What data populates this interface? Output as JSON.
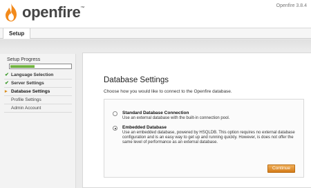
{
  "header": {
    "logo_text": "openfire",
    "trademark": "™",
    "version": "Openfire 3.8.4",
    "brand_color": "#f28a1c"
  },
  "tabs": {
    "setup_label": "Setup"
  },
  "sidebar": {
    "progress_title": "Setup Progress",
    "progress_fraction": 0.4,
    "progress_color": "#5ba82a",
    "steps": [
      {
        "label": "Language Selection",
        "status": "done",
        "icon": "check-icon"
      },
      {
        "label": "Server Settings",
        "status": "done",
        "icon": "check-icon"
      },
      {
        "label": "Database Settings",
        "status": "current",
        "icon": "arrow-icon"
      },
      {
        "label": "Profile Settings",
        "status": "todo",
        "icon": ""
      },
      {
        "label": "Admin Account",
        "status": "todo",
        "icon": ""
      }
    ]
  },
  "main": {
    "title": "Database Settings",
    "intro": "Choose how you would like to connect to the Openfire database.",
    "options": [
      {
        "title": "Standard Database Connection",
        "description": "Use an external database with the built-in connection pool.",
        "selected": false
      },
      {
        "title": "Embedded Database",
        "description": "Use an embedded database, powered by HSQLDB. This option requires no external database configuration and is an easy way to get up and running quickly. However, is does not offer the same level of performance as an external database.",
        "selected": true
      }
    ],
    "continue_label": "Continue"
  }
}
